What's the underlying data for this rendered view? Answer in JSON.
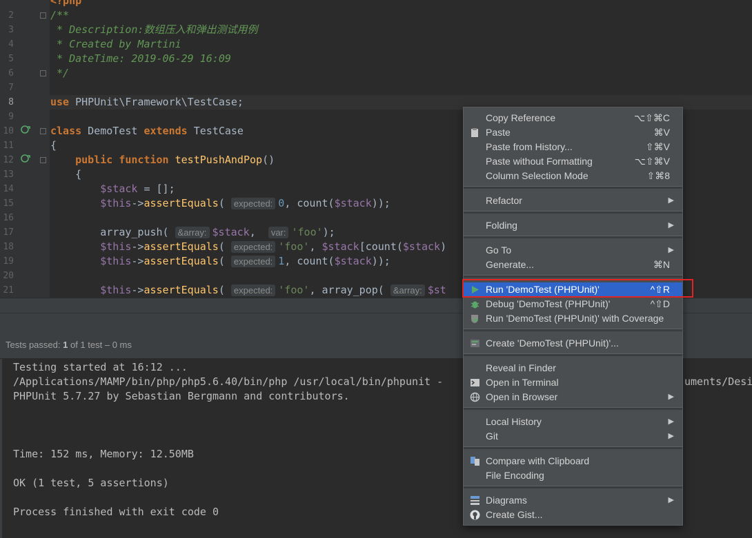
{
  "editor": {
    "line_numbers": [
      "2",
      "3",
      "4",
      "5",
      "6",
      "7",
      "8",
      "9",
      "10",
      "11",
      "12",
      "13",
      "14",
      "15",
      "16",
      "17",
      "18",
      "19",
      "20",
      "21"
    ],
    "php_open": "<?php",
    "doc_open": "/**",
    "doc_description": " * Description:数组压入和弹出测试用例",
    "doc_created": " * Created by Martini",
    "doc_datetime": " * DateTime: 2019-06-29 16:09",
    "doc_close": " */",
    "use_kw": "use",
    "use_path": " PHPUnit\\Framework\\TestCase;",
    "class_kw": "class",
    "class_name": " DemoTest ",
    "extends_kw": "extends",
    "parent_class": " TestCase",
    "brace_open": "{",
    "public_kw": "public",
    "function_kw": "function",
    "method_name": "testPushAndPop",
    "method_parens": "()",
    "inner_brace": "{",
    "stack_var": "$stack",
    "stack_assign": " = [];",
    "this_var": "$this",
    "arrow": "->",
    "assert_fn": "assertEquals",
    "hint_expected": "expected:",
    "hint_array": "&array:",
    "hint_var": "var:",
    "array_push_fn": "array_push(",
    "array_pop_fn": "array_pop(",
    "count_fn": "count(",
    "zero": "0",
    "one": "1",
    "foo": "'foo'",
    "stack_trunc": "$st",
    "stack_index_close": ")"
  },
  "status": {
    "tests_passed_label": "Tests passed:",
    "passed_count": "1",
    "of_text": "of 1 test",
    "duration": "– 0 ms"
  },
  "console": {
    "lines": [
      "Testing started at 16:12 ...",
      "/Applications/MAMP/bin/php/php5.6.40/bin/php /usr/local/bin/phpunit -",
      "PHPUnit 5.7.27 by Sebastian Bergmann and contributors.",
      "Time: 152 ms, Memory: 12.50MB",
      "OK (1 test, 5 assertions)",
      "Process finished with exit code 0"
    ],
    "right_fragment": "uments/Desi"
  },
  "menu": {
    "items": [
      {
        "label": "Copy Reference",
        "shortcut": "⌥⇧⌘C"
      },
      {
        "label": "Paste",
        "shortcut": "⌘V"
      },
      {
        "label": "Paste from History...",
        "shortcut": "⇧⌘V"
      },
      {
        "label": "Paste without Formatting",
        "shortcut": "⌥⇧⌘V"
      },
      {
        "label": "Column Selection Mode",
        "shortcut": "⇧⌘8"
      },
      {
        "label": "Refactor"
      },
      {
        "label": "Folding"
      },
      {
        "label": "Go To"
      },
      {
        "label": "Generate...",
        "shortcut": "⌘N"
      },
      {
        "label": "Run 'DemoTest (PHPUnit)'",
        "shortcut": "^⇧R"
      },
      {
        "label": "Debug 'DemoTest (PHPUnit)'",
        "shortcut": "^⇧D"
      },
      {
        "label": "Run 'DemoTest (PHPUnit)' with Coverage"
      },
      {
        "label": "Create 'DemoTest (PHPUnit)'..."
      },
      {
        "label": "Reveal in Finder"
      },
      {
        "label": "Open in Terminal"
      },
      {
        "label": "Open in Browser"
      },
      {
        "label": "Local History"
      },
      {
        "label": "Git"
      },
      {
        "label": "Compare with Clipboard"
      },
      {
        "label": "File Encoding"
      },
      {
        "label": "Diagrams"
      },
      {
        "label": "Create Gist..."
      }
    ],
    "submenu_arrow": "▶",
    "icons": {
      "paste": "paste-icon",
      "run": "run-icon",
      "debug": "debug-icon",
      "coverage": "coverage-icon",
      "create": "php-config-icon",
      "terminal": "terminal-icon",
      "browser": "globe-icon",
      "compare": "compare-icon",
      "diagrams": "diagram-icon",
      "gist": "github-icon"
    }
  },
  "colors": {
    "selection": "#2f65ca",
    "highlight_border": "#e02424",
    "run_green": "#59a869"
  }
}
